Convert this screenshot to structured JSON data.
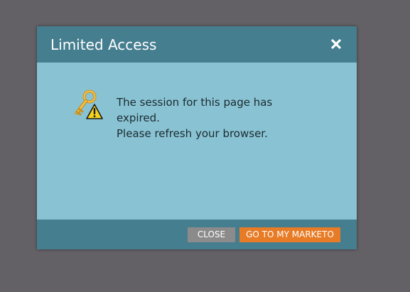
{
  "dialog": {
    "title": "Limited Access",
    "close_icon": "close-x-icon",
    "status_icon": "key-warning-icon",
    "message_lines": [
      "The session for this page has",
      "expired.",
      "Please refresh your browser."
    ],
    "buttons": {
      "close_label": "CLOSE",
      "go_label": "GO TO MY MARKETO"
    }
  },
  "colors": {
    "backdrop": "#636165",
    "header": "#457e8f",
    "body": "#89c3d3",
    "close_button": "#8b8b8b",
    "primary_button": "#e87b26"
  }
}
